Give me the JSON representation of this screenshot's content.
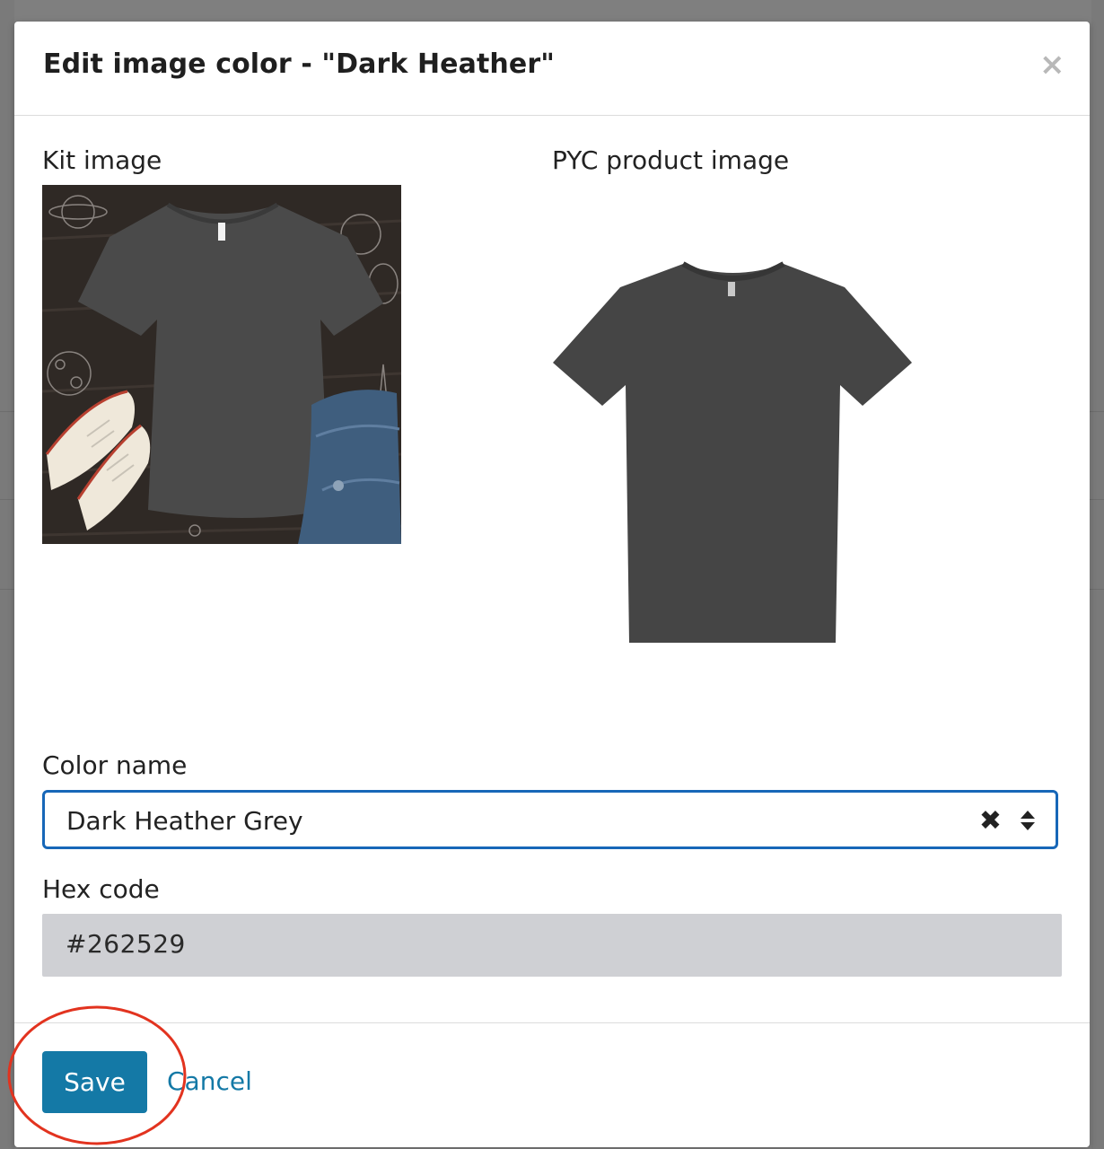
{
  "modal": {
    "title": "Edit image color - \"Dark Heather\"",
    "close_icon": "close-icon"
  },
  "images": {
    "kit_label": "Kit image",
    "pyc_label": "PYC product image"
  },
  "color_name": {
    "label": "Color name",
    "value": "Dark Heather Grey"
  },
  "hex_code": {
    "label": "Hex code",
    "value": "#262529"
  },
  "footer": {
    "save_label": "Save",
    "cancel_label": "Cancel"
  },
  "colors": {
    "accent": "#1479a6",
    "focus_border": "#1767b8",
    "annotation": "#e2331f",
    "shirt": "#454545"
  }
}
